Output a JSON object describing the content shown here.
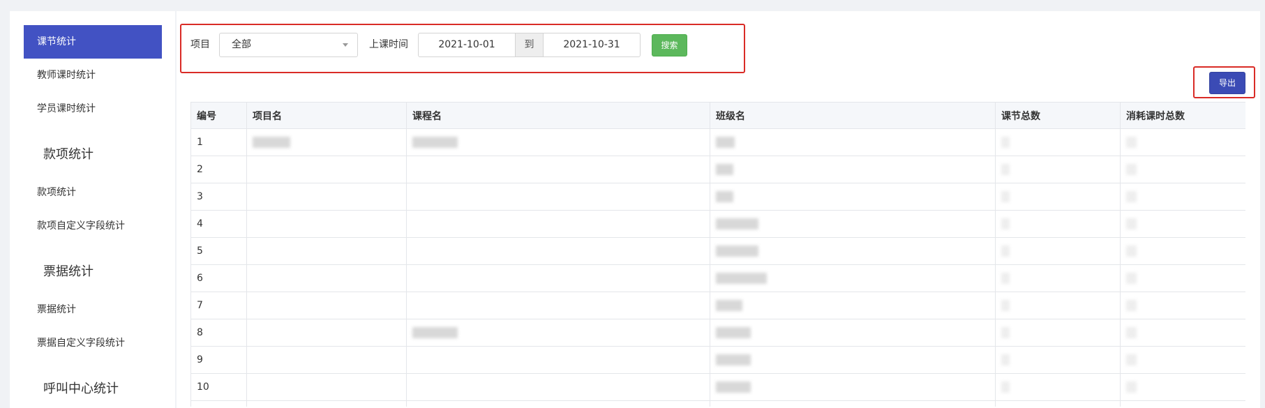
{
  "sidebar": {
    "groups": [
      {
        "items": [
          {
            "label": "课节统计",
            "active": true
          },
          {
            "label": "教师课时统计"
          },
          {
            "label": "学员课时统计"
          }
        ]
      },
      {
        "heading": "款项统计",
        "items": [
          {
            "label": "款项统计"
          },
          {
            "label": "款项自定义字段统计"
          }
        ]
      },
      {
        "heading": "票据统计",
        "items": [
          {
            "label": "票据统计"
          },
          {
            "label": "票据自定义字段统计"
          }
        ]
      },
      {
        "heading": "呼叫中心统计"
      }
    ]
  },
  "filter": {
    "project_label": "项目",
    "project_value": "全部",
    "time_label": "上课时间",
    "date_from": "2021-10-01",
    "date_separator": "到",
    "date_to": "2021-10-31",
    "search_label": "搜索"
  },
  "toolbar": {
    "export_label": "导出"
  },
  "table": {
    "columns": [
      "编号",
      "项目名",
      "课程名",
      "班级名",
      "课节总数",
      "消耗课时总数"
    ],
    "rows": [
      {
        "no": "1"
      },
      {
        "no": "2"
      },
      {
        "no": "3"
      },
      {
        "no": "4"
      },
      {
        "no": "5"
      },
      {
        "no": "6"
      },
      {
        "no": "7"
      },
      {
        "no": "8"
      },
      {
        "no": "9"
      },
      {
        "no": "10"
      }
    ]
  },
  "icons": {
    "project_select_caret": "caret-down-icon"
  },
  "colors": {
    "primary": "#4252c3",
    "primary_dark": "#3b4bb5",
    "success": "#5cb85c",
    "annotation": "#d92b26",
    "page_bg": "#f0f2f5"
  }
}
